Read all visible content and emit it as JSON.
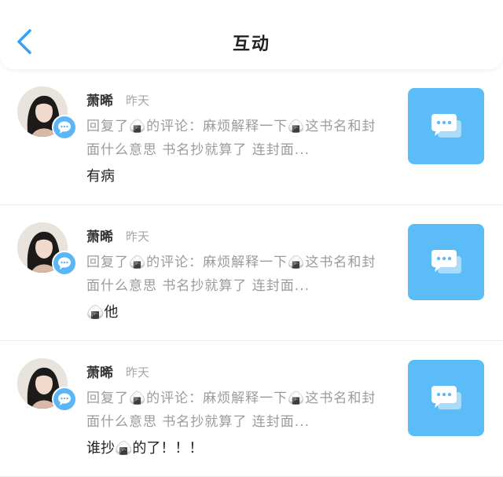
{
  "header": {
    "title": "互动",
    "back_icon": "chevron-left-icon"
  },
  "colors": {
    "accent": "#5bbcf8",
    "badge": "#5bb6f7"
  },
  "items": [
    {
      "name": "萧晞",
      "time": "昨天",
      "reply": "回复了🍙的评论：麻烦解释一下🍙这书名和封面什么意思 书名抄就算了 连封面...",
      "content": "有病"
    },
    {
      "name": "萧晞",
      "time": "昨天",
      "reply": "回复了🍙的评论：麻烦解释一下🍙这书名和封面什么意思 书名抄就算了 连封面...",
      "content": "🍙他"
    },
    {
      "name": "萧晞",
      "time": "昨天",
      "reply": "回复了🍙的评论：麻烦解释一下🍙这书名和封面什么意思 书名抄就算了 连封面...",
      "content": "谁抄🍙的了！！！"
    }
  ]
}
